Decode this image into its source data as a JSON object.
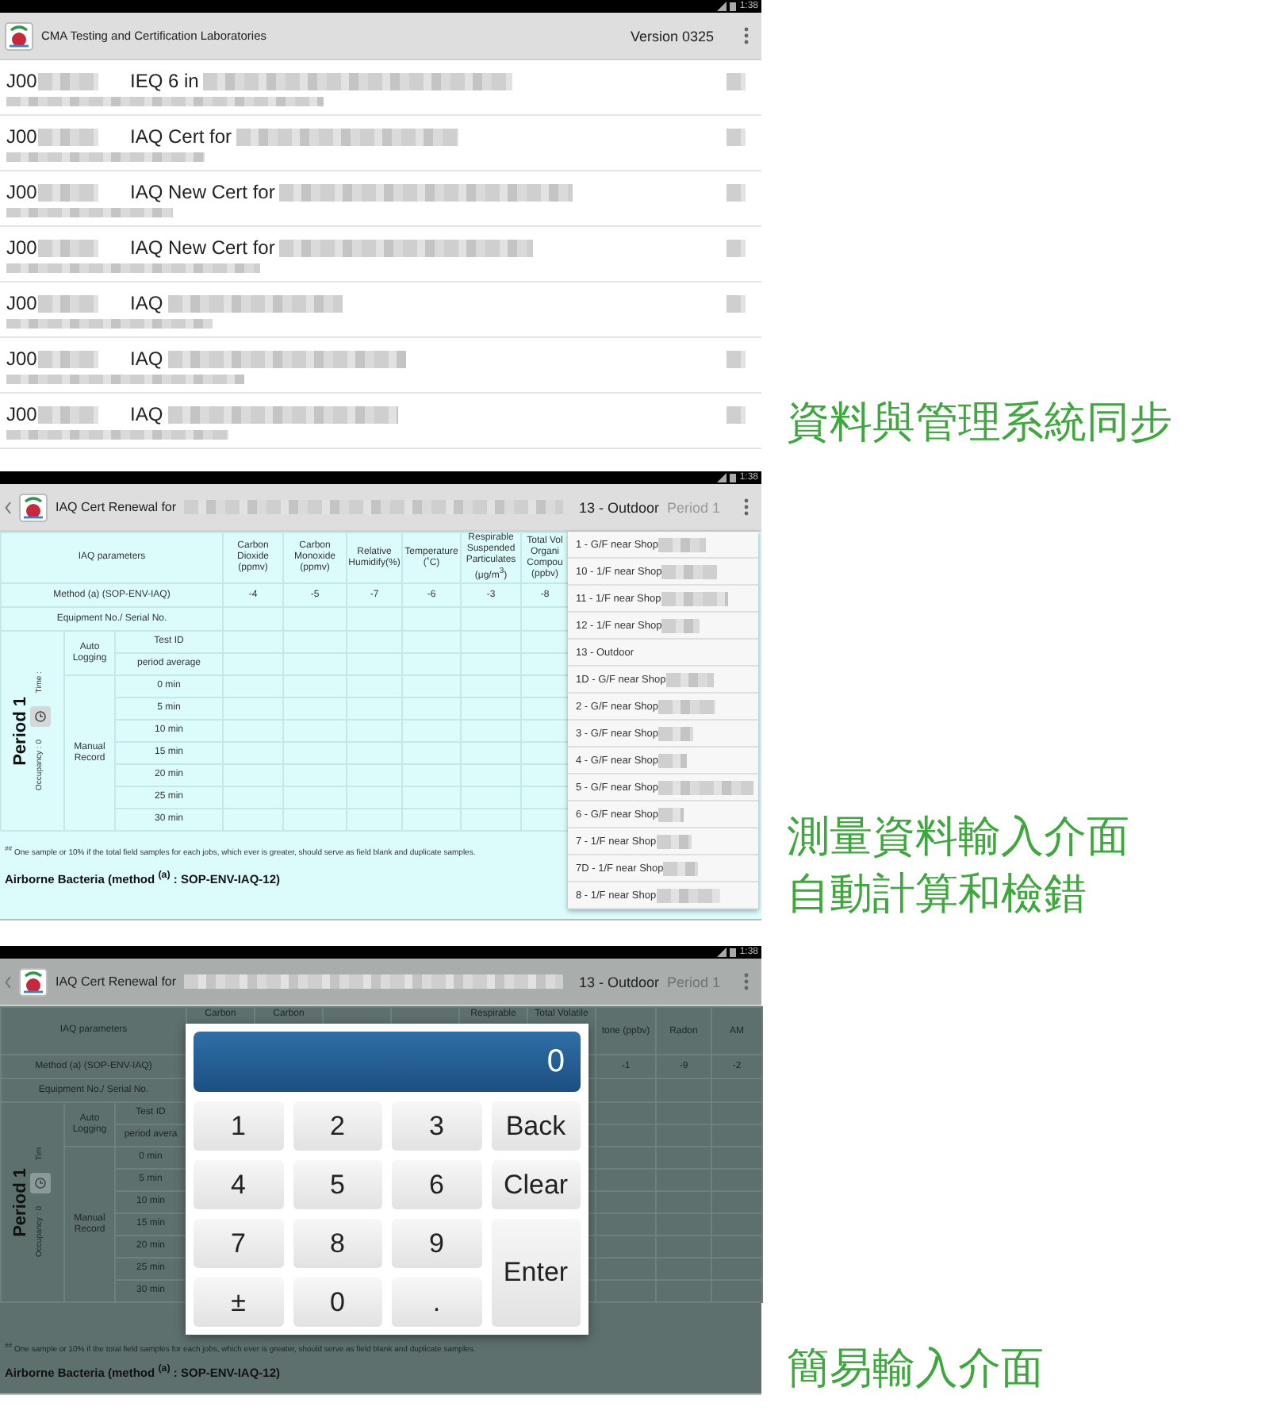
{
  "screens": [
    {
      "kind": "job_list",
      "status_bar": {
        "time": "1:38"
      },
      "app_bar": {
        "title": "CMA Testing and Certification Laboratories",
        "version": "Version 0325"
      },
      "jobs": [
        {
          "job_no": "J00",
          "title": "IEQ 6 in"
        },
        {
          "job_no": "J00",
          "title": "IAQ Cert for"
        },
        {
          "job_no": "J00",
          "title": "IAQ New Cert for"
        },
        {
          "job_no": "J00",
          "title": "IAQ New Cert for"
        },
        {
          "job_no": "J00",
          "title": "IAQ"
        },
        {
          "job_no": "J00",
          "title": "IAQ"
        },
        {
          "job_no": "J00",
          "title": "IAQ"
        }
      ],
      "caption": [
        "資料與管理系統同步"
      ]
    },
    {
      "kind": "data_entry",
      "status_bar": {
        "time": "1:38"
      },
      "app_bar": {
        "title": "IAQ Cert Renewal for",
        "location": "13 - Outdoor",
        "period": "Period 1",
        "period_disabled": true
      },
      "table": {
        "header_label": "IAQ parameters",
        "method_label": "Method (a) (SOP-ENV-IAQ)",
        "equipment_label": "Equipment No./ Serial No.",
        "columns": [
          {
            "header": "Carbon Dioxide (ppmv)",
            "method_value": "-4"
          },
          {
            "header": "Carbon Monoxide (ppmv)",
            "method_value": "-5"
          },
          {
            "header": "Relative Humidify(%)",
            "method_value": "-7"
          },
          {
            "header": "Temperature (˚C)",
            "method_value": "-6"
          },
          {
            "header": "Respirable Suspended Particulates (μg/m$^{3}$)",
            "method_value": "-3"
          },
          {
            "header": "Total Vol Organi Compou (ppbv)",
            "method_value": "-8"
          }
        ],
        "period": {
          "title": "Period 1",
          "time_label": "Time :",
          "occupancy_label": "Occupancy : 0",
          "groups": [
            {
              "label": "Auto Logging",
              "rows": [
                "Test ID",
                "period average"
              ]
            },
            {
              "label": "Manual Record",
              "rows": [
                "0 min",
                "5 min",
                "10 min",
                "15 min",
                "20 min",
                "25 min",
                "30 min"
              ]
            }
          ]
        },
        "footnote": "$^{##}$ One sample or 10% if the total field samples for each jobs, which ever is greater, should serve as field blank and duplicate samples.",
        "section_title": "Airborne Bacteria (method $^{(a)}$ : SOP-ENV-IAQ-12)"
      },
      "dropdown": {
        "items": [
          {
            "label": "1 - G/F near Shop"
          },
          {
            "label": "10 - 1/F near Shop"
          },
          {
            "label": "11 - 1/F near Shop"
          },
          {
            "label": "12 - 1/F near Shop"
          },
          {
            "label": "13 - Outdoor"
          },
          {
            "label": "1D - G/F near Shop"
          },
          {
            "label": "2 - G/F near Shop"
          },
          {
            "label": "3 - G/F near Shop"
          },
          {
            "label": "4 - G/F near Shop"
          },
          {
            "label": "5 - G/F near Shop"
          },
          {
            "label": "6 - G/F near Shop"
          },
          {
            "label": "7 - 1/F near Shop"
          },
          {
            "label": "7D - 1/F near Shop"
          },
          {
            "label": "8 - 1/F near Shop"
          }
        ]
      },
      "caption": [
        "測量資料輸入介面",
        "自動計算和檢錯"
      ]
    },
    {
      "kind": "keypad",
      "status_bar": {
        "time": "1:38"
      },
      "app_bar": {
        "title": "IAQ Cert Renewal for",
        "location": "13 - Outdoor",
        "period": "Period 1",
        "period_disabled": true
      },
      "table": {
        "header_label": "IAQ parameters",
        "method_label": "Method (a) (SOP-ENV-IAQ)",
        "equipment_label": "Equipment No./ Serial No.",
        "columns": [
          {
            "header": "Carbon"
          },
          {
            "header": "Carbon"
          },
          {},
          {},
          {
            "header": "Respirable"
          },
          {
            "header": "Total Volatile"
          },
          {
            "header": "tone (ppbv)",
            "method_value": "-1"
          },
          {
            "header": "Radon",
            "method_value": "-9"
          },
          {
            "header": "AM",
            "method_value": "-2"
          }
        ],
        "period": {
          "title": "Period 1",
          "time_label": "Tim",
          "occupancy_label": "Occupancy : 0",
          "groups": [
            {
              "label": "Auto Logging",
              "rows": [
                "Test ID",
                "period avera"
              ]
            },
            {
              "label": "Manual Record",
              "rows": [
                "0 min",
                "5 min",
                "10 min",
                "15 min",
                "20 min",
                "25 min",
                "30 min"
              ]
            }
          ]
        },
        "footnote": "$^{##}$ One sample or 10% if the total field samples for each jobs, which ever is greater, should serve as field blank and duplicate samples.",
        "section_title": "Airborne Bacteria (method $^{(a)}$ : SOP-ENV-IAQ-12)"
      },
      "keypad": {
        "display": "0",
        "keys": [
          {
            "label": "1",
            "kind": "key"
          },
          {
            "label": "2",
            "kind": "key"
          },
          {
            "label": "3",
            "kind": "key"
          },
          {
            "label": "Back",
            "kind": "key"
          },
          {
            "label": "4",
            "kind": "key"
          },
          {
            "label": "5",
            "kind": "key"
          },
          {
            "label": "6",
            "kind": "key"
          },
          {
            "label": "Clear",
            "kind": "key"
          },
          {
            "label": "7",
            "kind": "key"
          },
          {
            "label": "8",
            "kind": "key"
          },
          {
            "label": "9",
            "kind": "key"
          },
          {
            "label": "Enter",
            "kind": "tall"
          },
          {
            "label": "±",
            "kind": "key"
          },
          {
            "label": "0",
            "kind": "key"
          },
          {
            "label": ".",
            "kind": "key"
          }
        ]
      },
      "caption": [
        "簡易輸入介面"
      ]
    }
  ]
}
